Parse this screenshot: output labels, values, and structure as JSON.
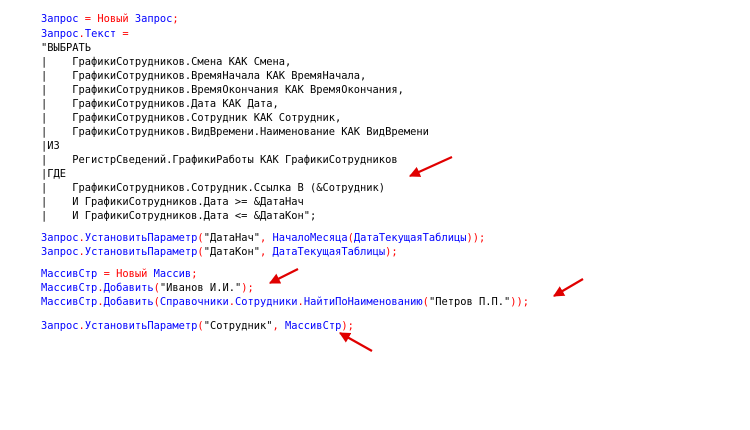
{
  "colors": {
    "keyword": "#0000ff",
    "operator": "#ff0000",
    "text": "#000000",
    "annotation_arrow": "#e00000",
    "background": "#ffffff"
  },
  "code_lines": [
    [
      {
        "t": "Запрос",
        "c": "blue"
      },
      {
        "t": " = ",
        "c": "red"
      },
      {
        "t": "Новый",
        "c": "red"
      },
      {
        "t": " ",
        "c": "black"
      },
      {
        "t": "Запрос",
        "c": "blue"
      },
      {
        "t": ";",
        "c": "red"
      }
    ],
    [
      {
        "t": "Запрос",
        "c": "blue"
      },
      {
        "t": ".",
        "c": "red"
      },
      {
        "t": "Текст",
        "c": "blue"
      },
      {
        "t": " =",
        "c": "red"
      }
    ],
    [
      {
        "t": "\"ВЫБРАТЬ",
        "c": "black"
      }
    ],
    [
      {
        "t": "|    ГрафикиСотрудников.Смена КАК Смена,",
        "c": "black"
      }
    ],
    [
      {
        "t": "|    ГрафикиСотрудников.ВремяНачала КАК ВремяНачала,",
        "c": "black"
      }
    ],
    [
      {
        "t": "|    ГрафикиСотрудников.ВремяОкончания КАК ВремяОкончания,",
        "c": "black"
      }
    ],
    [
      {
        "t": "|    ГрафикиСотрудников.Дата КАК Дата,",
        "c": "black"
      }
    ],
    [
      {
        "t": "|    ГрафикиСотрудников.Сотрудник КАК Сотрудник,",
        "c": "black"
      }
    ],
    [
      {
        "t": "|    ГрафикиСотрудников.ВидВремени.Наименование КАК ВидВремени",
        "c": "black"
      }
    ],
    [
      {
        "t": "|ИЗ",
        "c": "black"
      }
    ],
    [
      {
        "t": "|    РегистрСведений.ГрафикиРаботы КАК ГрафикиСотрудников",
        "c": "black"
      }
    ],
    [
      {
        "t": "|ГДЕ",
        "c": "black"
      }
    ],
    [
      {
        "t": "|    ГрафикиСотрудников.Сотрудник.Ссылка В (&Сотрудник)",
        "c": "black"
      }
    ],
    [
      {
        "t": "|    И ГрафикиСотрудников.Дата >= &ДатаНач",
        "c": "black"
      }
    ],
    [
      {
        "t": "|    И ГрафикиСотрудников.Дата <= &ДатаКон\";",
        "c": "black"
      }
    ],
    [],
    [
      {
        "t": "Запрос",
        "c": "blue"
      },
      {
        "t": ".",
        "c": "red"
      },
      {
        "t": "УстановитьПараметр",
        "c": "blue"
      },
      {
        "t": "(",
        "c": "red"
      },
      {
        "t": "\"ДатаНач\"",
        "c": "black"
      },
      {
        "t": ", ",
        "c": "red"
      },
      {
        "t": "НачалоМесяца",
        "c": "blue"
      },
      {
        "t": "(",
        "c": "red"
      },
      {
        "t": "ДатаТекущаяТаблицы",
        "c": "blue"
      },
      {
        "t": "));",
        "c": "red"
      }
    ],
    [
      {
        "t": "Запрос",
        "c": "blue"
      },
      {
        "t": ".",
        "c": "red"
      },
      {
        "t": "УстановитьПараметр",
        "c": "blue"
      },
      {
        "t": "(",
        "c": "red"
      },
      {
        "t": "\"ДатаКон\"",
        "c": "black"
      },
      {
        "t": ", ",
        "c": "red"
      },
      {
        "t": "ДатаТекущаяТаблицы",
        "c": "blue"
      },
      {
        "t": ");",
        "c": "red"
      }
    ],
    [],
    [
      {
        "t": "МассивСтр",
        "c": "blue"
      },
      {
        "t": " = ",
        "c": "red"
      },
      {
        "t": "Новый",
        "c": "red"
      },
      {
        "t": " ",
        "c": "black"
      },
      {
        "t": "Массив",
        "c": "blue"
      },
      {
        "t": ";",
        "c": "red"
      }
    ],
    [
      {
        "t": "МассивСтр",
        "c": "blue"
      },
      {
        "t": ".",
        "c": "red"
      },
      {
        "t": "Добавить",
        "c": "blue"
      },
      {
        "t": "(",
        "c": "red"
      },
      {
        "t": "\"Иванов И.И.\"",
        "c": "black"
      },
      {
        "t": ");",
        "c": "red"
      }
    ],
    [
      {
        "t": "МассивСтр",
        "c": "blue"
      },
      {
        "t": ".",
        "c": "red"
      },
      {
        "t": "Добавить",
        "c": "blue"
      },
      {
        "t": "(",
        "c": "red"
      },
      {
        "t": "Справочники",
        "c": "blue"
      },
      {
        "t": ".",
        "c": "red"
      },
      {
        "t": "Сотрудники",
        "c": "blue"
      },
      {
        "t": ".",
        "c": "red"
      },
      {
        "t": "НайтиПоНаименованию",
        "c": "blue"
      },
      {
        "t": "(",
        "c": "red"
      },
      {
        "t": "\"Петров П.П.\"",
        "c": "black"
      },
      {
        "t": "));",
        "c": "red"
      }
    ],
    [],
    [
      {
        "t": "Запрос",
        "c": "blue"
      },
      {
        "t": ".",
        "c": "red"
      },
      {
        "t": "УстановитьПараметр",
        "c": "blue"
      },
      {
        "t": "(",
        "c": "red"
      },
      {
        "t": "\"Сотрудник\"",
        "c": "black"
      },
      {
        "t": ", ",
        "c": "red"
      },
      {
        "t": "МассивСтр",
        "c": "blue"
      },
      {
        "t": ");",
        "c": "red"
      }
    ]
  ],
  "annotations": [
    {
      "name": "arrow-to-employee-parameter",
      "icon": "arrow-icon"
    },
    {
      "name": "arrow-to-ivanov-add",
      "icon": "arrow-icon"
    },
    {
      "name": "arrow-to-petrov-add",
      "icon": "arrow-icon"
    },
    {
      "name": "arrow-to-set-parameter",
      "icon": "arrow-icon"
    }
  ]
}
